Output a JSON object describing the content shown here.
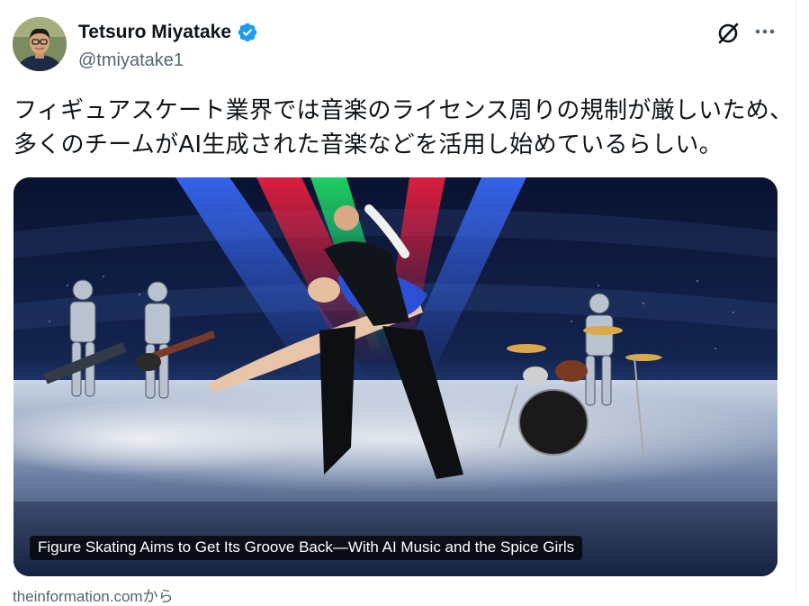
{
  "author": {
    "display_name": "Tetsuro Miyatake",
    "handle": "@tmiyatake1",
    "verified": true,
    "verified_badge_color": "#1d9bf0"
  },
  "actions": {
    "grok_icon": "grok-icon",
    "more_icon": "more-icon"
  },
  "tweet": {
    "text_line1": "フィギュアスケート業界では音楽のライセンス周りの規制が厳しいため、",
    "text_line2": "多くのチームがAI生成された音楽などを活用し始めているらしい。"
  },
  "card": {
    "title": "Figure Skating Aims to Get Its Groove Back—With AI Music and the Spice Girls",
    "source": "theinformation.comから"
  },
  "colors": {
    "text": "#0f1419",
    "secondary": "#536471",
    "accent": "#1d9bf0"
  }
}
